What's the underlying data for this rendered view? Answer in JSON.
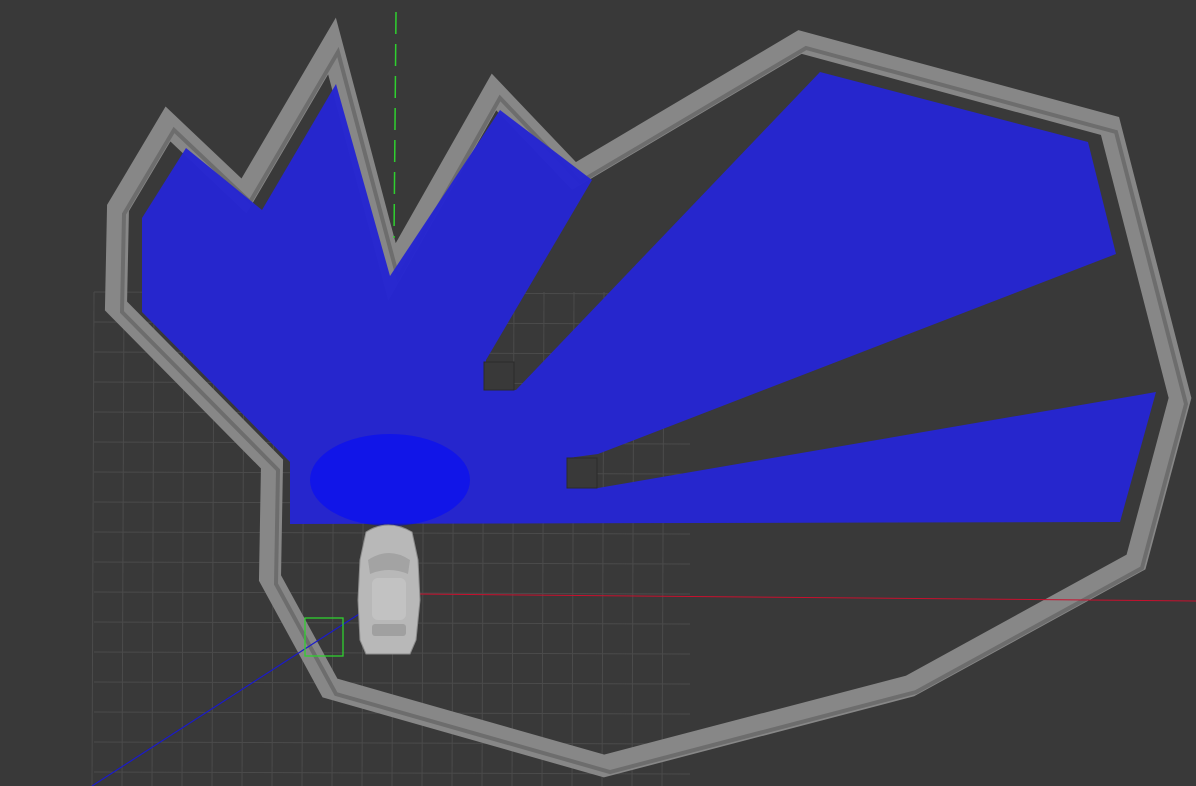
{
  "scene": {
    "background_color": "#393939",
    "grid_color": "#4a4a4a",
    "wall_color": "#8a8a8a",
    "wall_edge_color": "#6e6e6e",
    "lidar_color": "#1f1fd6",
    "lidar_core_color": "#0000ff",
    "car_color": "#b9b9b9",
    "x_axis_color": "#c8102e",
    "y_axis_color": "#2fd02f",
    "z_axis_color": "#1a1acc",
    "marker_color": "#2fd02f",
    "icons": [
      "car-model",
      "lidar-scan",
      "axis-marker"
    ]
  }
}
